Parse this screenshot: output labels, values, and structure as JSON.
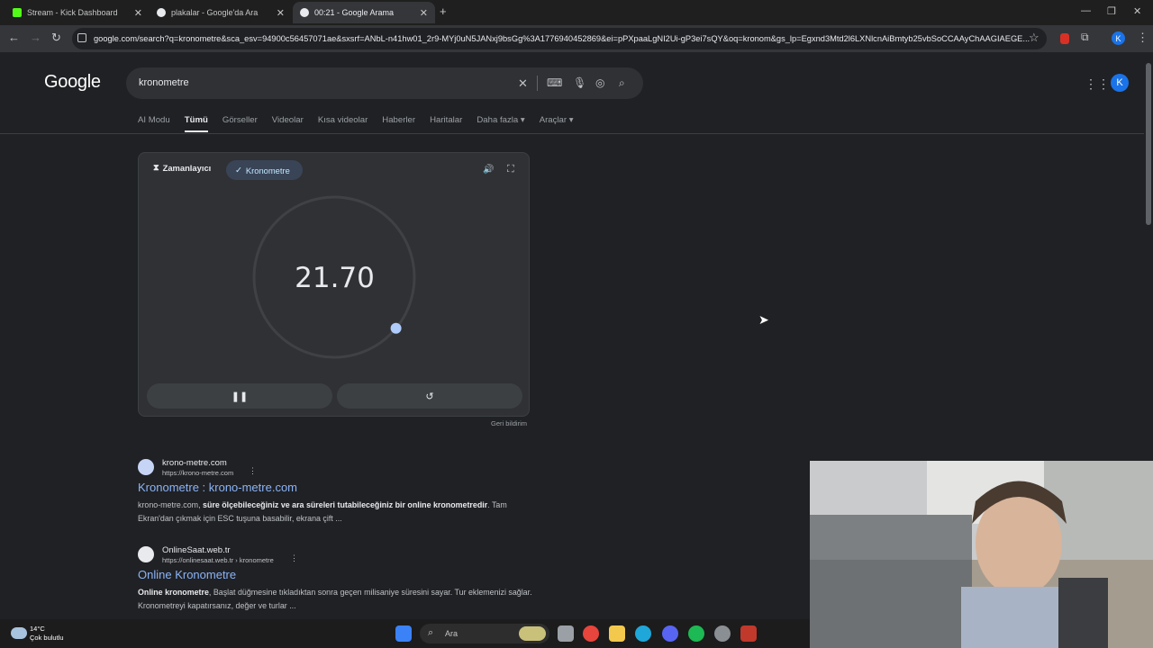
{
  "browser": {
    "tabs": [
      {
        "title": "Stream - Kick Dashboard",
        "favicon": "kick-icon",
        "color": "#53fc18"
      },
      {
        "title": "plakalar - Google'da Ara",
        "favicon": "google-icon",
        "color": "#e8eaed"
      },
      {
        "title": "00:21 - Google Arama",
        "favicon": "google-icon",
        "color": "#e8eaed",
        "active": true
      }
    ],
    "new_tab": "+",
    "url": "google.com/search?q=kronometre&sca_esv=94900c56457071ae&sxsrf=ANbL-n41hw01_2r9-MYj0uN5JANxj9bsGg%3A1776940452869&ei=pPXpaaLgNI2Ui-gP3ei7sQY&oq=kronom&gs_lp=Egxnd3Mtd2l6LXNlcnAiBmtyb25vbSoCCAAyChAAGIAEGE...",
    "profile_initial": "K"
  },
  "search": {
    "logo": "Google",
    "query": "kronometre",
    "nav_tabs": [
      "AI Modu",
      "Tümü",
      "Görseller",
      "Videolar",
      "Kısa videolar",
      "Haberler",
      "Haritalar",
      "Daha fazla ▾",
      "Araçlar ▾"
    ],
    "selected_tab": "Tümü",
    "avatar_initial": "K"
  },
  "stopwatch": {
    "timer_tab": "Zamanlayıcı",
    "stopwatch_tab": "Kronometre",
    "time": "21.70",
    "progress_fraction": 0.36,
    "pause_icon": "pause-icon",
    "reset_icon": "reset-icon",
    "feedback": "Geri bildirim"
  },
  "results": [
    {
      "site": "krono-metre.com",
      "url": "https://krono-metre.com",
      "title": "Kronometre : krono-metre.com",
      "snippet_pre": "krono-metre.com, ",
      "snippet_bold": "süre ölçebileceğiniz ve ara süreleri tutabileceğiniz bir online kronometredir",
      "snippet_post": ". Tam Ekran'dan çıkmak için ESC tuşuna basabilir, ekrana çift ..."
    },
    {
      "site": "OnlineSaat.web.tr",
      "url": "https://onlinesaat.web.tr › kronometre",
      "title": "Online Kronometre",
      "snippet_pre": "",
      "snippet_bold": "Online kronometre",
      "snippet_post": ", Başlat düğmesine tıkladıktan sonra geçen milisaniye süresini sayar. Tur eklemenizi sağlar. Kronometreyi kapatırsanız, değer ve turlar ..."
    }
  ],
  "taskbar": {
    "temperature": "14°C",
    "weather": "Çok bulutlu",
    "search_placeholder": "Ara"
  }
}
